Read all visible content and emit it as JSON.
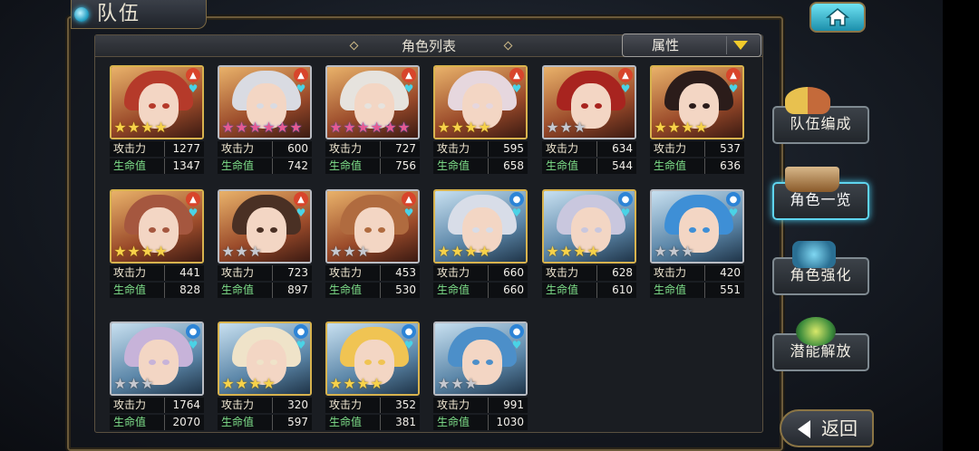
{
  "header": {
    "title": "队伍"
  },
  "panel": {
    "title": "角色列表",
    "filter_label": "属性"
  },
  "side_menu": [
    {
      "label": "队伍编成",
      "active": false
    },
    {
      "label": "角色一览",
      "active": true
    },
    {
      "label": "角色强化",
      "active": false
    },
    {
      "label": "潜能解放",
      "active": false
    }
  ],
  "back_button": {
    "label": "返回"
  },
  "stat_labels": {
    "attack": "攻击力",
    "hp": "生命值"
  },
  "cards": [
    {
      "element": "fire",
      "stars": 4,
      "star_color": "gold",
      "frame": "gold",
      "hair": "#b53a2a",
      "attack": "1277",
      "hp": "1347"
    },
    {
      "element": "fire",
      "stars": 6,
      "star_color": "rainbow",
      "frame": "silver",
      "hair": "#d9dbe2",
      "attack": "600",
      "hp": "742"
    },
    {
      "element": "fire",
      "stars": 6,
      "star_color": "rainbow",
      "frame": "silver",
      "hair": "#e6e3de",
      "attack": "727",
      "hp": "756"
    },
    {
      "element": "fire",
      "stars": 4,
      "star_color": "gold",
      "frame": "gold",
      "hair": "#e6d7de",
      "attack": "595",
      "hp": "658"
    },
    {
      "element": "fire",
      "stars": 3,
      "star_color": "gray",
      "frame": "silver",
      "hair": "#a8241f",
      "attack": "634",
      "hp": "544"
    },
    {
      "element": "fire",
      "stars": 4,
      "star_color": "gold",
      "frame": "gold",
      "hair": "#2b1c1a",
      "attack": "537",
      "hp": "636"
    },
    {
      "element": "fire",
      "stars": 4,
      "star_color": "gold",
      "frame": "gold",
      "hair": "#a5573f",
      "attack": "441",
      "hp": "828"
    },
    {
      "element": "fire",
      "stars": 3,
      "star_color": "gray",
      "frame": "silver",
      "hair": "#4a3024",
      "attack": "723",
      "hp": "897"
    },
    {
      "element": "fire",
      "stars": 3,
      "star_color": "gray",
      "frame": "silver",
      "hair": "#b06b3f",
      "attack": "453",
      "hp": "530"
    },
    {
      "element": "water",
      "stars": 4,
      "star_color": "gold",
      "frame": "gold",
      "hair": "#d8dde8",
      "attack": "660",
      "hp": "660"
    },
    {
      "element": "water",
      "stars": 4,
      "star_color": "gold",
      "frame": "gold",
      "hair": "#c9c7de",
      "attack": "628",
      "hp": "610"
    },
    {
      "element": "water",
      "stars": 3,
      "star_color": "gray",
      "frame": "silver",
      "hair": "#3e8fd6",
      "attack": "420",
      "hp": "551"
    },
    {
      "element": "water",
      "stars": 3,
      "star_color": "gray",
      "frame": "silver",
      "hair": "#c7b3d9",
      "attack": "1764",
      "hp": "2070"
    },
    {
      "element": "water",
      "stars": 4,
      "star_color": "gold",
      "frame": "gold",
      "hair": "#efe3c9",
      "attack": "320",
      "hp": "597"
    },
    {
      "element": "water",
      "stars": 4,
      "star_color": "gold",
      "frame": "gold",
      "hair": "#f0c453",
      "attack": "352",
      "hp": "381"
    },
    {
      "element": "water",
      "stars": 3,
      "star_color": "gray",
      "frame": "silver",
      "hair": "#4c8fc9",
      "attack": "991",
      "hp": "1030"
    }
  ],
  "colors": {
    "fire": "#d8452b",
    "water": "#2d84d6",
    "accent": "#49c7e9"
  }
}
